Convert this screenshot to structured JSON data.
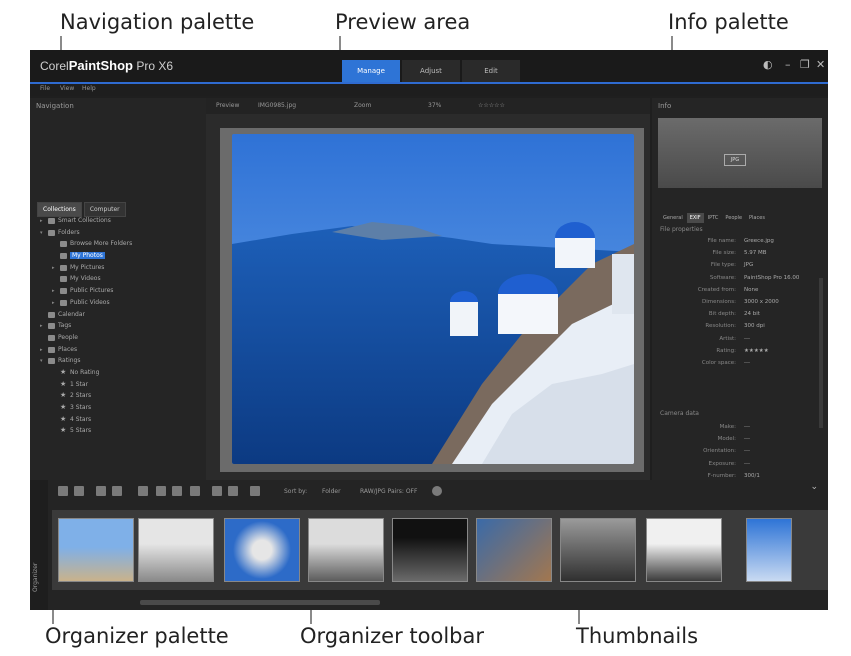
{
  "callouts": {
    "navigation_palette": "Navigation palette",
    "preview_area": "Preview area",
    "info_palette": "Info palette",
    "organizer_palette": "Organizer palette",
    "organizer_toolbar": "Organizer toolbar",
    "thumbnails": "Thumbnails"
  },
  "app": {
    "title_prefix": "Corel",
    "title_main": "PaintShop",
    "title_suffix": "Pro X6",
    "tabs": [
      "Manage",
      "Adjust",
      "Edit"
    ],
    "menu": [
      "File",
      "View",
      "Help"
    ]
  },
  "navigation": {
    "title": "Navigation",
    "tabs": [
      "Collections",
      "Computer"
    ],
    "tree": [
      {
        "label": "Smart Collections",
        "twisty": "▸",
        "indent": 0
      },
      {
        "label": "Folders",
        "twisty": "▾",
        "indent": 0
      },
      {
        "label": "Browse More Folders",
        "twisty": "",
        "indent": 1
      },
      {
        "label": "My Photos",
        "twisty": "",
        "indent": 1,
        "selected": true
      },
      {
        "label": "My Pictures",
        "twisty": "▸",
        "indent": 1
      },
      {
        "label": "My Videos",
        "twisty": "",
        "indent": 1
      },
      {
        "label": "Public Pictures",
        "twisty": "▸",
        "indent": 1
      },
      {
        "label": "Public Videos",
        "twisty": "▸",
        "indent": 1
      },
      {
        "label": "Calendar",
        "twisty": "",
        "indent": 0
      },
      {
        "label": "Tags",
        "twisty": "▸",
        "indent": 0
      },
      {
        "label": "People",
        "twisty": "",
        "indent": 0
      },
      {
        "label": "Places",
        "twisty": "▸",
        "indent": 0
      },
      {
        "label": "Ratings",
        "twisty": "▾",
        "indent": 0
      },
      {
        "label": "No Rating",
        "twisty": "",
        "indent": 1,
        "star": true
      },
      {
        "label": "1 Star",
        "twisty": "",
        "indent": 1,
        "star": true
      },
      {
        "label": "2 Stars",
        "twisty": "",
        "indent": 1,
        "star": true
      },
      {
        "label": "3 Stars",
        "twisty": "",
        "indent": 1,
        "star": true
      },
      {
        "label": "4 Stars",
        "twisty": "",
        "indent": 1,
        "star": true
      },
      {
        "label": "5 Stars",
        "twisty": "",
        "indent": 1,
        "star": true
      }
    ]
  },
  "preview": {
    "mode": "Preview",
    "file": "IMG0985.jpg",
    "zoom_label": "Zoom",
    "zoom_value": "37%",
    "rating": "☆☆☆☆☆"
  },
  "info": {
    "title": "Info",
    "thumb_tag": "JPG",
    "tabs": [
      "General",
      "EXIF",
      "IPTC",
      "People",
      "Places"
    ],
    "section_file": "File properties",
    "section_camera": "Camera data",
    "file_props": [
      {
        "k": "File name:",
        "v": "Greece.jpg"
      },
      {
        "k": "File size:",
        "v": "5.97 MB"
      },
      {
        "k": "File type:",
        "v": "JPG"
      },
      {
        "k": "Software:",
        "v": "PaintShop Pro 16.00"
      },
      {
        "k": "Created from:",
        "v": "None"
      },
      {
        "k": "Dimensions:",
        "v": "3000 x 2000"
      },
      {
        "k": "Bit depth:",
        "v": "24 bit"
      },
      {
        "k": "Resolution:",
        "v": "300 dpi"
      },
      {
        "k": "Artist:",
        "v": "---"
      },
      {
        "k": "Rating:",
        "v": "★★★★★"
      },
      {
        "k": "Color space:",
        "v": "---"
      }
    ],
    "camera_props": [
      {
        "k": "Make:",
        "v": "---"
      },
      {
        "k": "Model:",
        "v": "---"
      },
      {
        "k": "Orientation:",
        "v": "---"
      },
      {
        "k": "Exposure:",
        "v": "---"
      },
      {
        "k": "F-number:",
        "v": "300/1"
      }
    ]
  },
  "organizer": {
    "label": "Organizer",
    "sort_label": "Sort by:",
    "sort_value": "Folder",
    "raw_label": "RAW/JPG Pairs: OFF"
  }
}
